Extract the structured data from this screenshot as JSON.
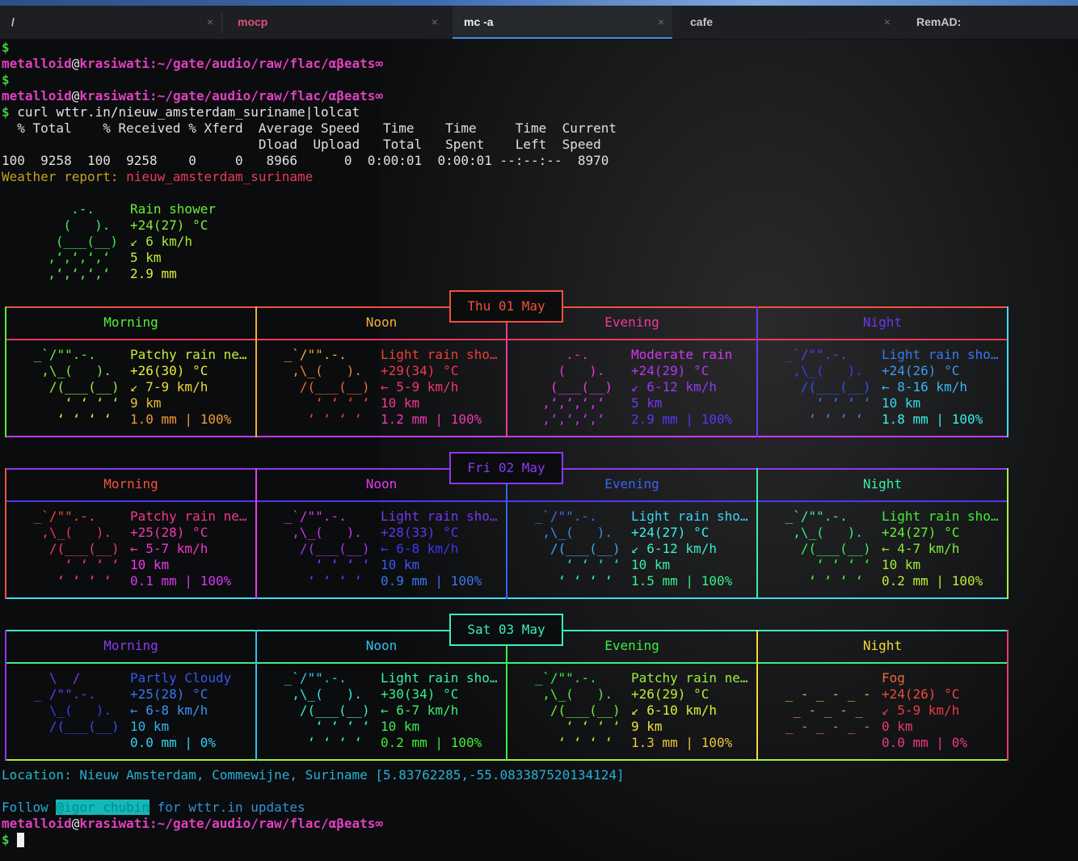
{
  "tabs": [
    {
      "label": "/",
      "close": "×"
    },
    {
      "label": "mocp",
      "close": "×"
    },
    {
      "label": "mc -a",
      "close": "×",
      "active": true
    },
    {
      "label": "cafe",
      "close": "×"
    },
    {
      "label": "RemAD:"
    }
  ],
  "prompt": {
    "user": "metalloid",
    "at": "@",
    "host": "krasiwati",
    "path": ":~/gate/audio/raw/flac/αβeats∞",
    "dollar": "$"
  },
  "command": "curl wttr.in/nieuw_amsterdam_suriname|lolcat",
  "curl": {
    "header1": "  % Total    % Received % Xferd  Average Speed   Time    Time     Time  Current",
    "header2": "                                 Dload  Upload   Total   Spent    Left  Speed",
    "values": "100  9258  100  9258    0     0   8966      0  0:00:01  0:00:01 --:--:--  8970"
  },
  "report": {
    "label": "Weather report: ",
    "place": "nieuw_amsterdam_suriname"
  },
  "current": {
    "art": [
      "     .-.",
      "    (   ).",
      "   (___(__)",
      "  ‚ʻ‚ʻ‚ʻ‚ʻ",
      "  ‚ʻ‚ʻ‚ʻ‚ʻ"
    ],
    "lines": [
      "Rain shower",
      "+24(27) °C",
      "↙ 6 km/h",
      "5 km",
      "2.9 mm"
    ]
  },
  "periods": [
    "Morning",
    "Noon",
    "Evening",
    "Night"
  ],
  "days": [
    {
      "date": " Thu 01 May ",
      "cells": [
        {
          "art": " _`/\"\".-.",
          "lines": [
            "Patchy rain ne…",
            "+26(30) °C",
            "↙ 7-9 km/h",
            "9 km",
            "1.0 mm | 100%"
          ],
          "kind": "patchy"
        },
        {
          "lines": [
            "Light rain sho…",
            "+29(34) °C",
            "← 5-9 km/h",
            "10 km",
            "1.2 mm | 100%"
          ],
          "kind": "patchy"
        },
        {
          "lines": [
            "Moderate rain",
            "+24(29) °C",
            "↙ 6-12 km/h",
            "5 km",
            "2.9 mm | 100%"
          ],
          "kind": "moderate"
        },
        {
          "lines": [
            "Light rain sho…",
            "+24(26) °C",
            "← 8-16 km/h",
            "10 km",
            "1.8 mm | 100%"
          ],
          "kind": "patchy"
        }
      ]
    },
    {
      "date": " Fri 02 May ",
      "cells": [
        {
          "lines": [
            "Patchy rain ne…",
            "+25(28) °C",
            "← 5-7 km/h",
            "10 km",
            "0.1 mm | 100%"
          ],
          "kind": "patchy"
        },
        {
          "lines": [
            "Light rain sho…",
            "+28(33) °C",
            "← 6-8 km/h",
            "10 km",
            "0.9 mm | 100%"
          ],
          "kind": "patchy"
        },
        {
          "lines": [
            "Light rain sho…",
            "+24(27) °C",
            "↙ 6-12 km/h",
            "10 km",
            "1.5 mm | 100%"
          ],
          "kind": "patchy"
        },
        {
          "lines": [
            "Light rain sho…",
            "+24(27) °C",
            "← 4-7 km/h",
            "10 km",
            "0.2 mm | 100%"
          ],
          "kind": "patchy"
        }
      ]
    },
    {
      "date": " Sat 03 May ",
      "cells": [
        {
          "lines": [
            "Partly Cloudy",
            "+25(28) °C",
            "← 6-8 km/h",
            "10 km",
            "0.0 mm | 0%"
          ],
          "kind": "partly"
        },
        {
          "lines": [
            "Light rain sho…",
            "+30(34) °C",
            "← 6-7 km/h",
            "10 km",
            "0.2 mm | 100%"
          ],
          "kind": "patchy"
        },
        {
          "lines": [
            "Patchy rain ne…",
            "+26(29) °C",
            "↙ 6-10 km/h",
            "9 km",
            "1.3 mm | 100%"
          ],
          "kind": "patchy"
        },
        {
          "lines": [
            "Fog",
            "+24(26) °C",
            "↙ 5-9 km/h",
            "0 km",
            "0.0 mm | 0%"
          ],
          "kind": "fog"
        }
      ]
    }
  ],
  "art_sets": {
    "patchy": [
      " _`/\"\".-.",
      "  ,\\_(   ).",
      "   /(___(__)",
      "     ʻ ʻ ʻ ʻ",
      "    ʻ ʻ ʻ ʻ"
    ],
    "moderate": [
      "     .-.",
      "    (   ).",
      "   (___(__)",
      "  ‚ʻ‚ʻ‚ʻ‚ʻ",
      "  ‚ʻ‚ʻ‚ʻ‚ʻ"
    ],
    "partly": [
      "   \\  /",
      " _ /\"\".-.",
      "   \\_(   ).",
      "   /(___(__)",
      ""
    ],
    "fog": [
      "",
      " _ - _ - _ -",
      "  _ - _ - _",
      " _ - _ - _ -",
      ""
    ]
  },
  "location": {
    "label": "Location: ",
    "value": "Nieuw Amsterdam, Commewijne, Suriname [5.83762285,-55.083387520134124]"
  },
  "follow": {
    "pre": "Follow ",
    "handle": "@igor_chubin",
    "post": " for wttr.in updates"
  },
  "colors": {
    "tab_active_underline": "#3d8ee0",
    "prompt": "#e040c0",
    "dollar": "#3ec83e",
    "report_label": "#c8a020",
    "report_place": "#e83c58"
  }
}
